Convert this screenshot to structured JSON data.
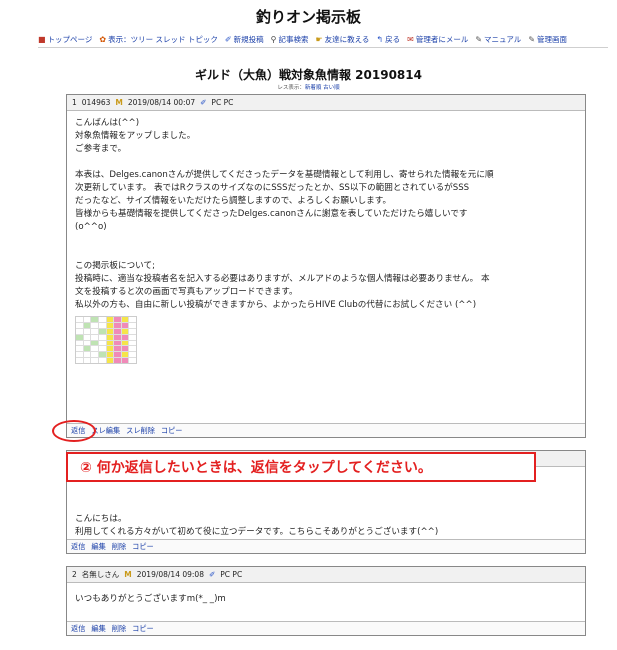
{
  "site_title": "釣りオン掲示板",
  "menu": [
    {
      "icon": "■",
      "label": "トップページ"
    },
    {
      "icon": "✿",
      "label": "表示：ツリー スレッド トピック"
    },
    {
      "icon": "✐",
      "label": "新規投稿"
    },
    {
      "icon": "⚲",
      "label": "記事検索"
    },
    {
      "icon": "☛",
      "label": "友達に教える"
    },
    {
      "icon": "↰",
      "label": "戻る"
    },
    {
      "icon": "✉",
      "label": "管理者にメール"
    },
    {
      "icon": "✎",
      "label": "マニュアル"
    },
    {
      "icon": "✎",
      "label": "管理画面"
    }
  ],
  "thread_title": "ギルド（大魚）戦対象魚情報 20190814",
  "view_line": {
    "prefix": "レス表示：",
    "new": "新着順",
    "old": "古い順"
  },
  "posts": [
    {
      "num": "1",
      "id": "014963",
      "date": "2019/08/14 00:07",
      "device": "PC PC",
      "lines": [
        "こんばんは(^^)",
        "対象魚情報をアップしました。",
        "ご参考まで。",
        "",
        "本表は、Delges.canonさんが提供してくださったデータを基礎情報として利用し、寄せられた情報を元に順",
        "次更新しています。 表ではRクラスのサイズなのにSSSだったとか、SS以下の範囲とされているがSSS",
        "だったなど、サイズ情報をいただけたら調整しますので、よろしくお願いします。",
        "皆様からも基礎情報を提供してくださったDelges.canonさんに謝意を表していただけたら嬉しいです",
        "(o^^o)",
        "",
        "",
        "この掲示板について;",
        "投稿時に、適当な投稿者名を記入する必要はありますが、メルアドのような個人情報は必要ありません。 本",
        "文を投稿すると次の画面で写真もアップロードできます。",
        "私以外の方も、自由に新しい投稿ができますから、よかったらHIVE Clubの代替にお試しください (^^)"
      ],
      "actions": [
        "返信",
        "スレ編集",
        "スレ削除",
        "コピー"
      ]
    },
    {
      "lines": [
        "こんにちは。",
        "利用してくれる方々がいて初めて役に立つデータです。こちらこそありがとうございます(^^)"
      ],
      "actions": [
        "返信",
        "編集",
        "削除",
        "コピー"
      ]
    },
    {
      "num": "2",
      "author": "名無しさん",
      "date": "2019/08/14 09:08",
      "device": "PC PC",
      "lines": [
        "いつもありがとうございますm(*_ _)m"
      ],
      "actions": [
        "返信",
        "編集",
        "削除",
        "コピー"
      ]
    }
  ],
  "callout": "② 何か返信したいときは、返信をタップしてください。",
  "colors": {
    "link": "#1a3fa8",
    "callout_red": "#e32020"
  }
}
